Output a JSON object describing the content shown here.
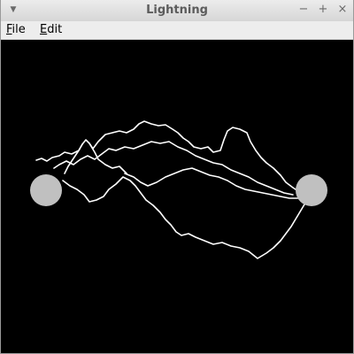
{
  "window": {
    "title": "Lightning",
    "controls": {
      "minimize": "−",
      "maximize": "+",
      "close": "×"
    },
    "window_menu_glyph": "▼"
  },
  "menubar": {
    "items": [
      {
        "label": "File",
        "mnemonic": "F",
        "rest": "ile"
      },
      {
        "label": "Edit",
        "mnemonic": "E",
        "rest": "dit"
      }
    ]
  },
  "scene": {
    "background": "#000000",
    "bolt_color": "#ffffff",
    "endpoint_color": "#c0c0c0",
    "endpoints": [
      "left-endpoint",
      "right-endpoint"
    ]
  }
}
